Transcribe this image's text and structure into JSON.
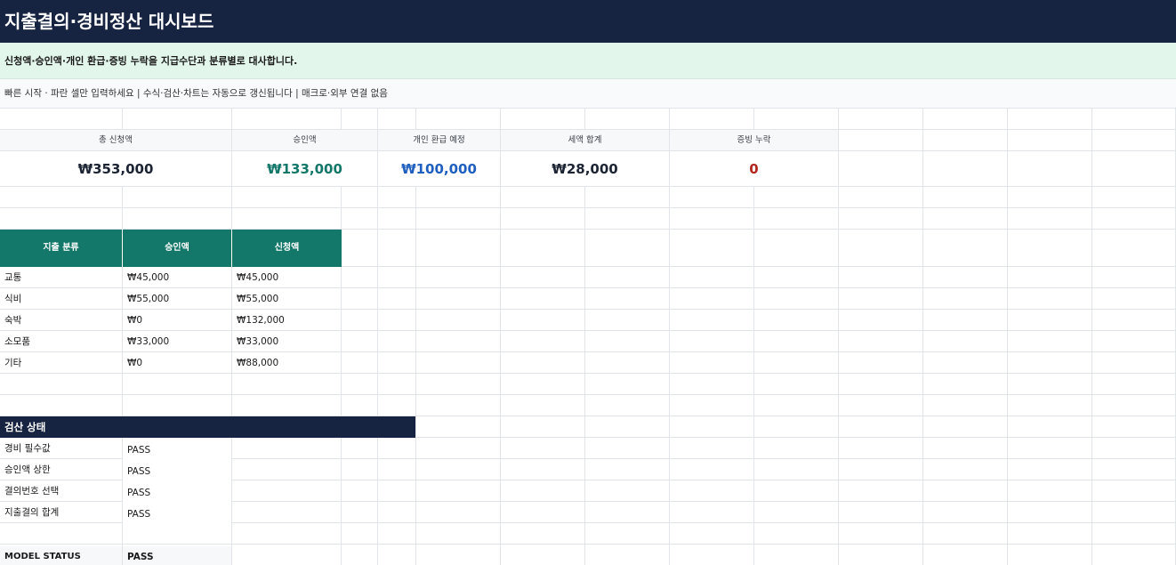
{
  "header": {
    "title": "지출결의·경비정산 대시보드",
    "subtitle": "신청액·승인액·개인 환급·증빙 누락을 지급수단과 분류별로 대사합니다.",
    "hint": "빠른 시작 · 파란 셀만 입력하세요  |  수식·검산·차트는 자동으로 갱신됩니다  |  매크로·외부 연결 없음"
  },
  "kpis": [
    {
      "label": "총 신청액",
      "value": "₩353,000",
      "color": "#1c2433"
    },
    {
      "label": "승인액",
      "value": "₩133,000",
      "color": "#137769"
    },
    {
      "label": "개인 환급 예정",
      "value": "₩100,000",
      "color": "#1f5fbf"
    },
    {
      "label": "세액 합계",
      "value": "₩28,000",
      "color": "#1c2433"
    },
    {
      "label": "증빙 누락",
      "value": "0",
      "color": "#b3261e"
    }
  ],
  "category_table": {
    "headers": [
      "지출 분류",
      "승인액",
      "신청액"
    ],
    "rows": [
      {
        "category": "교통",
        "approved": "₩45,000",
        "requested": "₩45,000"
      },
      {
        "category": "식비",
        "approved": "₩55,000",
        "requested": "₩55,000"
      },
      {
        "category": "숙박",
        "approved": "₩0",
        "requested": "₩132,000"
      },
      {
        "category": "소모품",
        "approved": "₩33,000",
        "requested": "₩33,000"
      },
      {
        "category": "기타",
        "approved": "₩0",
        "requested": "₩88,000"
      }
    ]
  },
  "checks": {
    "title": "검산 상태",
    "rows": [
      {
        "label": "경비 필수값",
        "status": "PASS"
      },
      {
        "label": "승인액 상한",
        "status": "PASS"
      },
      {
        "label": "결의번호 선택",
        "status": "PASS"
      },
      {
        "label": "지출결의 합계",
        "status": "PASS"
      }
    ],
    "model_label": "MODEL STATUS",
    "model_status": "PASS"
  },
  "colors": {
    "title_bg": "#172441",
    "subtitle_bg": "#e3f6ec",
    "table_header_bg": "#137769"
  }
}
